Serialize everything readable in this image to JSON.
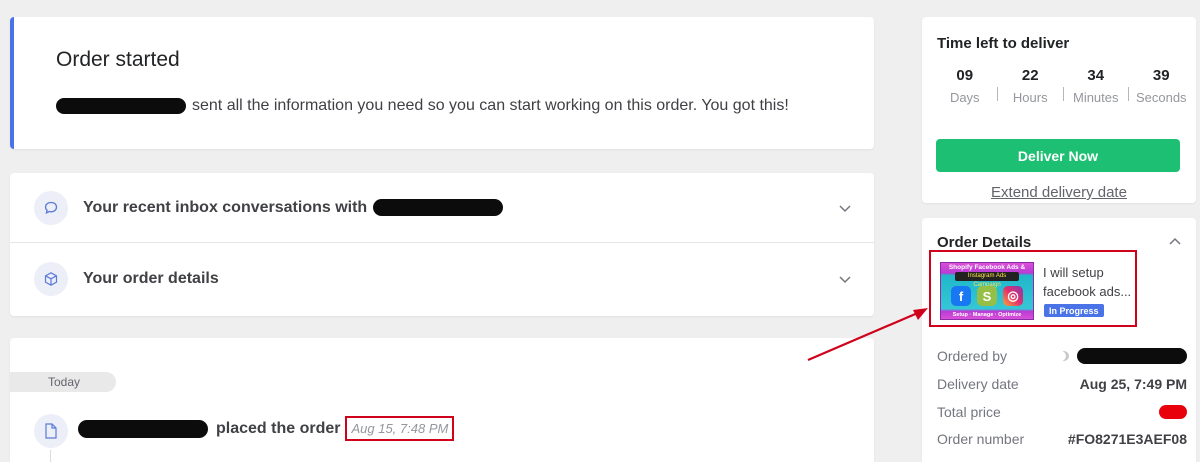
{
  "order_started": {
    "title": "Order started",
    "message": "sent all the information you need so you can start working on this order. You got this!"
  },
  "accordion": {
    "inbox_label": "Your recent inbox conversations with",
    "details_label": "Your order details"
  },
  "activity": {
    "day_label": "Today",
    "event_text": "placed the order",
    "event_date": "Aug 15, 7:48 PM"
  },
  "time_left": {
    "title": "Time left to deliver",
    "units": [
      {
        "value": "09",
        "label": "Days"
      },
      {
        "value": "22",
        "label": "Hours"
      },
      {
        "value": "34",
        "label": "Minutes"
      },
      {
        "value": "39",
        "label": "Seconds"
      }
    ],
    "deliver_button": "Deliver Now",
    "extend_link": "Extend delivery date"
  },
  "order_details": {
    "title": "Order Details",
    "gig": {
      "title_line1": "I will setup",
      "title_line2": "facebook ads...",
      "status": "In Progress",
      "thumb_title": "Shopify Facebook Ads &",
      "thumb_subtitle": "Instagram Ads Campaign",
      "thumb_footer": "Setup · Manage · Optimize"
    },
    "rows": [
      {
        "key": "Ordered by",
        "value": ""
      },
      {
        "key": "Delivery date",
        "value": "Aug 25, 7:49 PM"
      },
      {
        "key": "Total price",
        "value": ""
      },
      {
        "key": "Order number",
        "value": "#FO8271E3AEF08"
      }
    ]
  },
  "colors": {
    "accent_blue": "#4a73e8",
    "deliver_green": "#1dbf73",
    "highlight_red": "#d0021b"
  }
}
